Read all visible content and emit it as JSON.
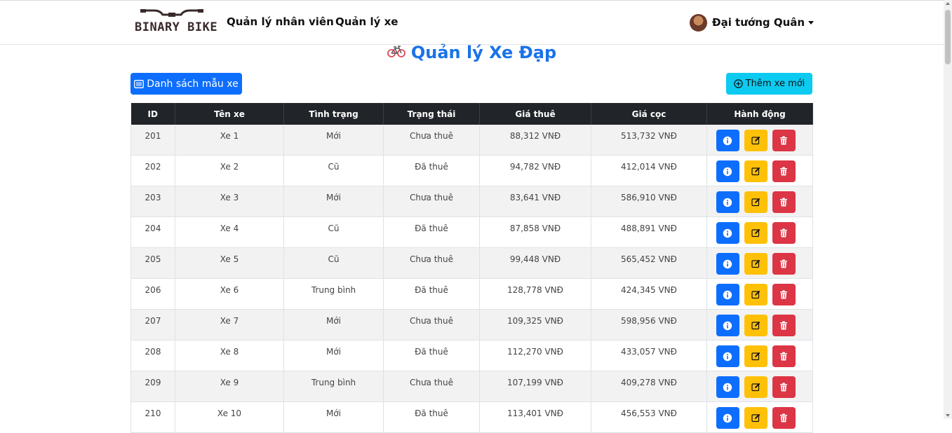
{
  "brand": {
    "logo_text": "BINARY BIKE"
  },
  "nav": {
    "links": [
      "Quản lý nhân viên",
      "Quản lý xe"
    ]
  },
  "user": {
    "name": "Đại tướng Quân"
  },
  "page": {
    "title": "Quản lý Xe Đạp",
    "list_button": "Danh sách mẫu xe",
    "add_button": "Thêm xe mới"
  },
  "table": {
    "headers": [
      "ID",
      "Tên xe",
      "Tình trạng",
      "Trạng thái",
      "Giá thuê",
      "Giá cọc",
      "Hành động"
    ],
    "rows": [
      [
        "201",
        "Xe 1",
        "Mới",
        "Chưa thuê",
        "88,312 VNĐ",
        "513,732 VNĐ"
      ],
      [
        "202",
        "Xe 2",
        "Cũ",
        "Đã thuê",
        "94,782 VNĐ",
        "412,014 VNĐ"
      ],
      [
        "203",
        "Xe 3",
        "Mới",
        "Chưa thuê",
        "83,641 VNĐ",
        "586,910 VNĐ"
      ],
      [
        "204",
        "Xe 4",
        "Cũ",
        "Đã thuê",
        "87,858 VNĐ",
        "488,891 VNĐ"
      ],
      [
        "205",
        "Xe 5",
        "Cũ",
        "Chưa thuê",
        "99,448 VNĐ",
        "565,452 VNĐ"
      ],
      [
        "206",
        "Xe 6",
        "Trung bình",
        "Đã thuê",
        "128,778 VNĐ",
        "424,345 VNĐ"
      ],
      [
        "207",
        "Xe 7",
        "Mới",
        "Chưa thuê",
        "109,325 VNĐ",
        "598,956 VNĐ"
      ],
      [
        "208",
        "Xe 8",
        "Mới",
        "Đã thuê",
        "112,270 VNĐ",
        "433,057 VNĐ"
      ],
      [
        "209",
        "Xe 9",
        "Trung bình",
        "Chưa thuê",
        "107,199 VNĐ",
        "409,278 VNĐ"
      ],
      [
        "210",
        "Xe 10",
        "Mới",
        "Đã thuê",
        "113,401 VNĐ",
        "456,553 VNĐ"
      ]
    ]
  },
  "icons": {
    "list": "list-icon",
    "add": "plus-circle-icon",
    "info": "info-icon",
    "edit": "edit-icon",
    "delete": "trash-icon",
    "title": "bicycle-icon"
  },
  "colors": {
    "primary": "#0d6efd",
    "info_button": "#0dcaf0",
    "warning": "#ffc107",
    "danger": "#dc3545",
    "header_dark": "#212529",
    "title_blue": "#1a73e8"
  }
}
